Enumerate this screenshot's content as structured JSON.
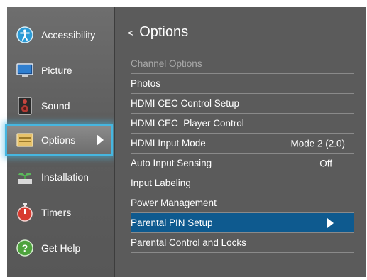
{
  "sidebar": {
    "items": [
      {
        "label": "Accessibility",
        "icon": "accessibility-icon"
      },
      {
        "label": "Picture",
        "icon": "picture-icon"
      },
      {
        "label": "Sound",
        "icon": "sound-icon"
      },
      {
        "label": "Options",
        "icon": "options-icon"
      },
      {
        "label": "Installation",
        "icon": "installation-icon"
      },
      {
        "label": "Timers",
        "icon": "timers-icon"
      },
      {
        "label": "Get Help",
        "icon": "get-help-icon"
      }
    ],
    "selected": "Options"
  },
  "main": {
    "back_glyph": "<",
    "title": "Options",
    "rows": [
      {
        "label": "Channel Options",
        "value": "",
        "disabled": true
      },
      {
        "label": "Photos",
        "value": ""
      },
      {
        "label": "HDMI CEC Control Setup",
        "value": ""
      },
      {
        "label": "HDMI CEC  Player Control",
        "value": ""
      },
      {
        "label": "HDMI Input Mode",
        "value": "Mode 2 (2.0)"
      },
      {
        "label": "Auto Input Sensing",
        "value": "Off"
      },
      {
        "label": "Input Labeling",
        "value": ""
      },
      {
        "label": "Power Management",
        "value": ""
      },
      {
        "label": "Parental PIN Setup",
        "value": "",
        "highlighted": true
      },
      {
        "label": "Parental Control and Locks",
        "value": ""
      }
    ]
  },
  "colors": {
    "accent": "#46b6e0",
    "highlight": "#0e5a8f",
    "panel": "#5b5b5b"
  }
}
